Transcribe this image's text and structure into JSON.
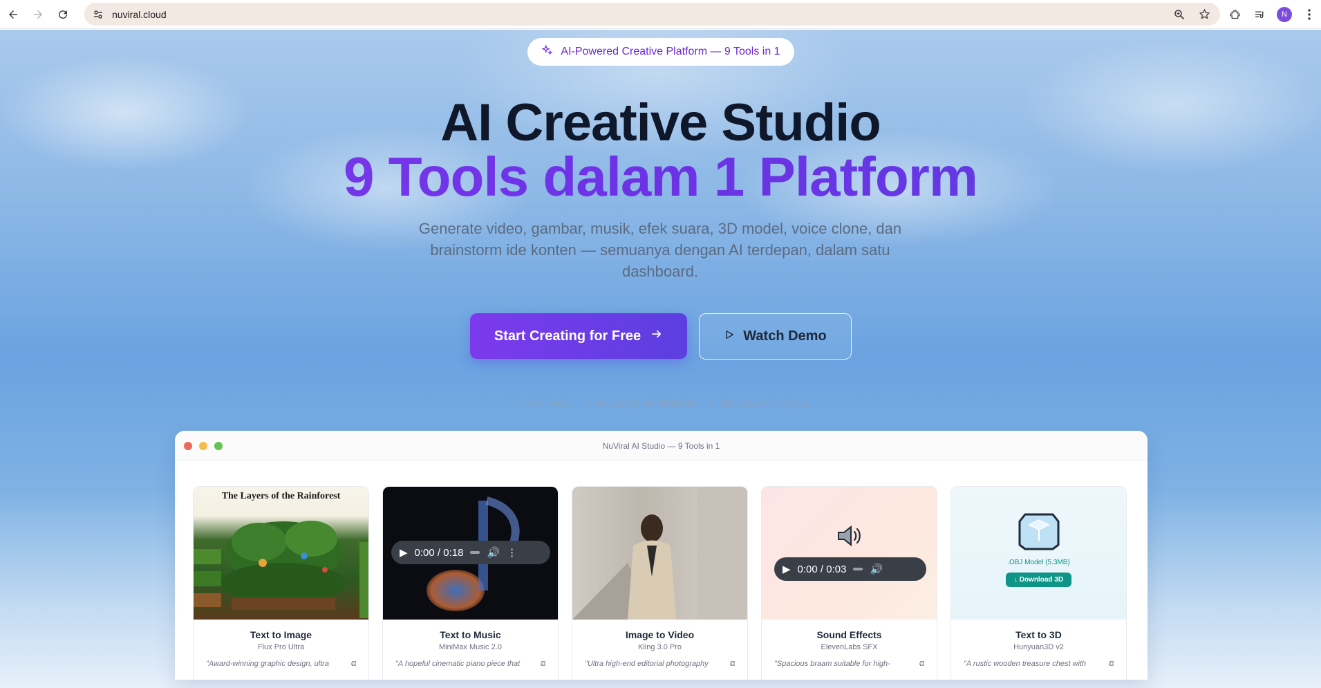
{
  "browser": {
    "url": "nuviral.cloud",
    "avatar_letter": "N"
  },
  "hero": {
    "badge": "AI-Powered Creative Platform — 9 Tools in 1",
    "title_line1": "AI Creative Studio",
    "title_line2": "9 Tools dalam 1 Platform",
    "subtitle": "Generate video, gambar, musik, efek suara, 3D model, voice clone, dan brainstorm ide konten — semuanya dengan AI terdepan, dalam satu dashboard.",
    "cta_primary": "Start Creating for Free",
    "cta_secondary": "Watch Demo",
    "checks": [
      "✓ 9 AI Tools",
      "✓ Mulai Rp 45.000/bln",
      "✓ Bahasa Indonesia"
    ]
  },
  "studio": {
    "window_title": "NuViral AI Studio — 9 Tools in 1",
    "cards": [
      {
        "title": "Text to Image",
        "model": "Flux Pro Ultra",
        "prompt": "\"Award-winning graphic design, ultra",
        "thumb_caption": "The Layers of the Rainforest"
      },
      {
        "title": "Text to Music",
        "model": "MiniMax Music 2.0",
        "prompt": "\"A hopeful cinematic piano piece that",
        "audio_time": "0:00 / 0:18"
      },
      {
        "title": "Image to Video",
        "model": "Kling 3.0 Pro",
        "prompt": "\"Ultra high-end editorial photography"
      },
      {
        "title": "Sound Effects",
        "model": "ElevenLabs SFX",
        "prompt": "\"Spacious braam suitable for high-",
        "audio_time": "0:00 / 0:03"
      },
      {
        "title": "Text to 3D",
        "model": "Hunyuan3D v2",
        "prompt": "\"A rustic wooden treasure chest with",
        "file_label": ".OBJ Model (5.3MB)",
        "download_label": "↓ Download 3D"
      }
    ]
  },
  "colors": {
    "accent": "#6d32e6",
    "teal": "#0f9488"
  }
}
